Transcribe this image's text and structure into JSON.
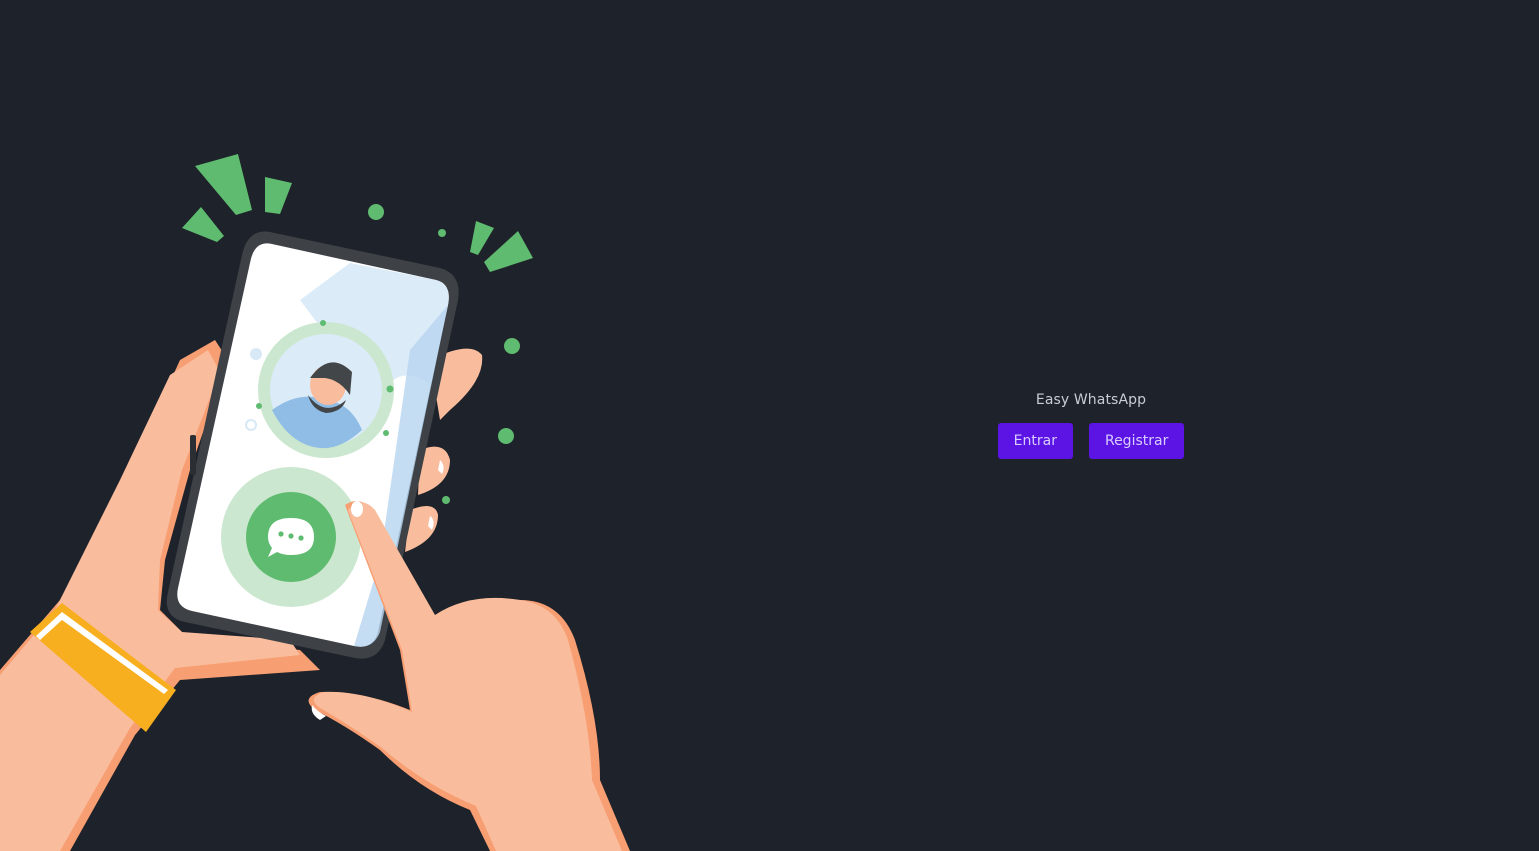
{
  "app": {
    "title": "Easy WhatsApp"
  },
  "actions": {
    "login_label": "Entrar",
    "register_label": "Registrar"
  },
  "colors": {
    "background": "#1e222a",
    "button": "#5b14e4",
    "accent_green": "#5fbb6f",
    "skin": "#f9bd9d",
    "watch_band": "#f7ae1f"
  },
  "illustration": {
    "icons": [
      "hand-holding-phone-illustration",
      "chat-bubble-icon",
      "contact-avatar-icon"
    ]
  }
}
